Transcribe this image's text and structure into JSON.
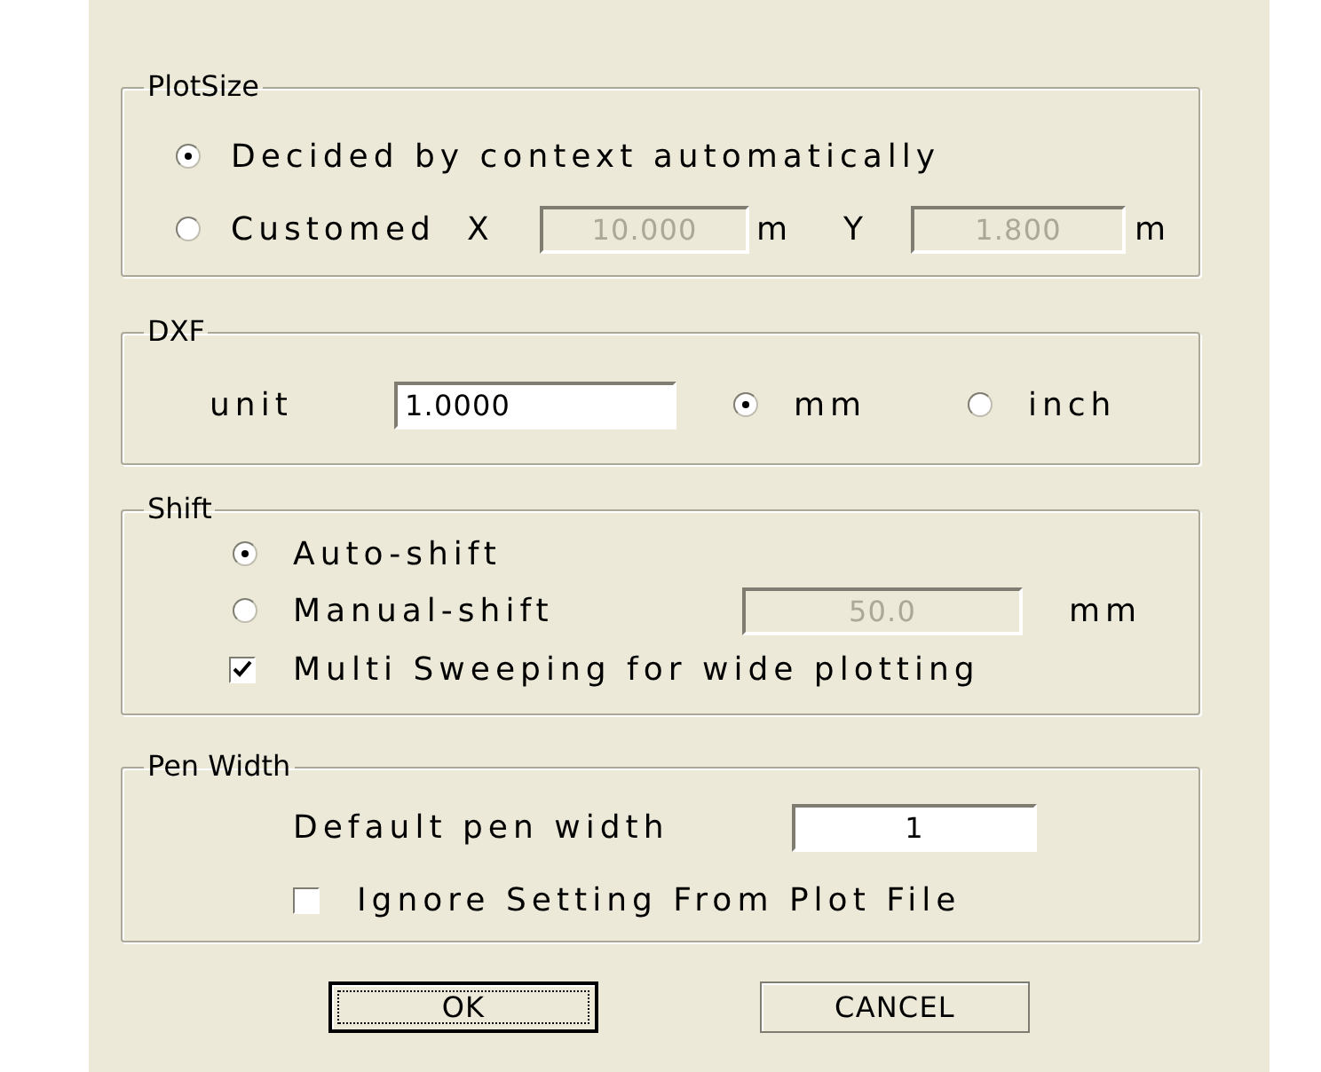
{
  "plot_size": {
    "legend": "PlotSize",
    "options": [
      {
        "label": "Decided by context automatically",
        "selected": true
      },
      {
        "label": "Customed",
        "selected": false
      }
    ],
    "custom": {
      "x_label": "X",
      "x_value": "10.000",
      "x_unit": "m",
      "y_label": "Y",
      "y_value": "1.800",
      "y_unit": "m",
      "disabled": true
    }
  },
  "dxf": {
    "legend": "DXF",
    "unit_label": "unit",
    "unit_value": "1.0000",
    "options": [
      {
        "label": "mm",
        "selected": true
      },
      {
        "label": "inch",
        "selected": false
      }
    ]
  },
  "shift": {
    "legend": "Shift",
    "options": [
      {
        "label": "Auto-shift",
        "selected": true
      },
      {
        "label": "Manual-shift",
        "selected": false
      }
    ],
    "manual_value": "50.0",
    "manual_unit": "mm",
    "manual_disabled": true,
    "multi_sweep": {
      "label": "Multi Sweeping for wide plotting",
      "checked": true
    }
  },
  "pen_width": {
    "legend": "Pen Width",
    "default_label": "Default pen width",
    "default_value": "1",
    "ignore": {
      "label": "Ignore Setting From Plot File",
      "checked": false
    }
  },
  "buttons": [
    {
      "label": "OK",
      "focused": true
    },
    {
      "label": "CANCEL",
      "focused": false
    }
  ]
}
